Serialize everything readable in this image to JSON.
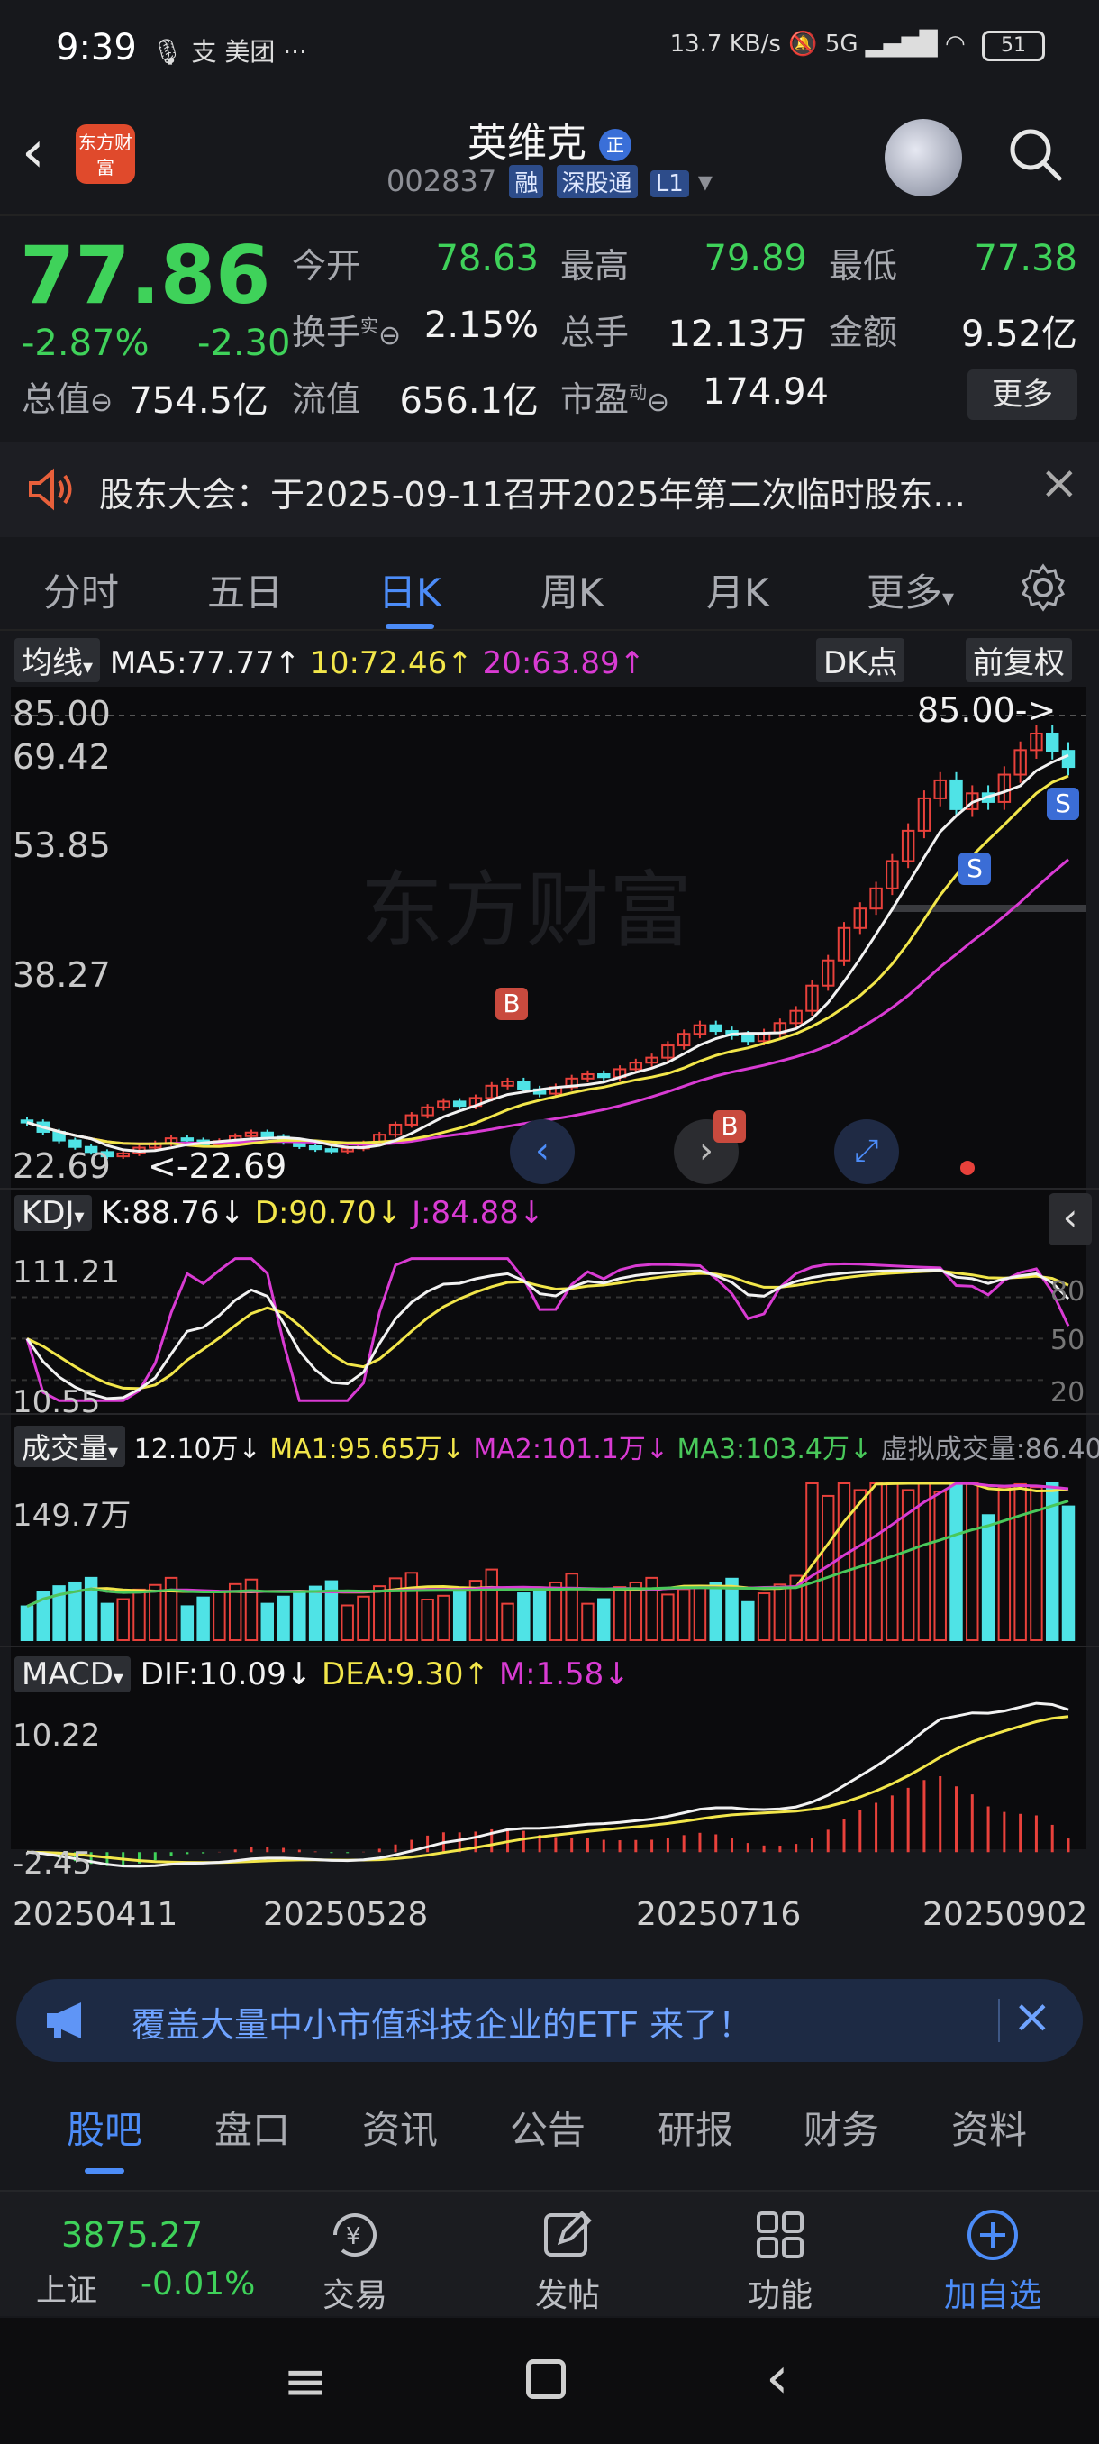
{
  "status_bar": {
    "time": "9:39",
    "app_icons": "🎙 支 美团 ···",
    "network_speed": "13.7 KB/s",
    "network_type": "5G",
    "battery": "51"
  },
  "header": {
    "back_icon": "chevron-left-icon",
    "logo_text": "东方财富",
    "stock_name": "英维克",
    "badge": "正",
    "code": "002837",
    "tags": [
      "融",
      "深股通",
      "L1"
    ]
  },
  "quote": {
    "price": "77.86",
    "change_pct": "-2.87%",
    "change": "-2.30",
    "fields": [
      {
        "label": "今开",
        "value": "78.63",
        "color": "green"
      },
      {
        "label": "最高",
        "value": "79.89",
        "color": "green"
      },
      {
        "label": "最低",
        "value": "77.38",
        "color": "green"
      },
      {
        "label": "换手",
        "sup": "实",
        "value": "2.15%",
        "color": "white"
      },
      {
        "label": "总手",
        "value": "12.13万",
        "color": "white"
      },
      {
        "label": "金额",
        "value": "9.52亿",
        "color": "white"
      },
      {
        "label": "总值",
        "value": "754.5亿",
        "color": "white"
      },
      {
        "label": "流值",
        "value": "656.1亿",
        "color": "white"
      },
      {
        "label": "市盈",
        "sup": "动",
        "value": "174.94",
        "color": "white"
      }
    ],
    "more_label": "更多"
  },
  "notice": {
    "text": "股东大会：于2025-09-11召开2025年第二次临时股东..."
  },
  "kline_tabs": [
    "分时",
    "五日",
    "日K",
    "周K",
    "月K",
    "更多"
  ],
  "kline_active": "日K",
  "chart": {
    "ma_chip": "均线",
    "ma5": "MA5:77.77",
    "ma10": "10:72.46",
    "ma20": "20:63.89",
    "dk_chip": "DK点",
    "fq_chip": "前复权",
    "price_axis": [
      "85.00",
      "69.42",
      "53.85",
      "38.27",
      "22.69"
    ],
    "high_marker": "85.00->",
    "low_marker": "<-22.69",
    "watermark": "东方财富",
    "kdj_chip": "KDJ",
    "kdj_k": "K:88.76",
    "kdj_d": "D:90.70",
    "kdj_j": "J:84.88",
    "kdj_axis": [
      "111.21",
      "80",
      "50",
      "20",
      "10.55"
    ],
    "vol_chip": "成交量",
    "vol_now": "12.10万",
    "vol_ma1": "MA1:95.65万",
    "vol_ma2": "MA2:101.1万",
    "vol_ma3": "MA3:103.4万",
    "vol_virtual": "虚拟成交量:86.40万",
    "vol_axis": "149.7万",
    "macd_chip": "MACD",
    "macd_dif": "DIF:10.09",
    "macd_dea": "DEA:9.30",
    "macd_m": "M:1.58",
    "macd_axis": [
      "10.22",
      "-2.45"
    ],
    "dates": [
      "20250411",
      "20250528",
      "20250716",
      "20250902"
    ],
    "signals": {
      "buy": "B",
      "sell": "S"
    }
  },
  "chart_data": {
    "type": "candlestick",
    "price_range": [
      22.69,
      85.0
    ],
    "close": [
      28.5,
      27.2,
      26.0,
      25.1,
      24.4,
      23.8,
      24.2,
      25.0,
      25.6,
      26.3,
      26.0,
      25.4,
      25.9,
      26.6,
      27.1,
      26.5,
      25.8,
      25.2,
      24.8,
      24.5,
      24.9,
      25.6,
      26.8,
      28.2,
      29.5,
      30.6,
      31.4,
      30.8,
      31.9,
      33.6,
      34.2,
      33.1,
      32.5,
      33.4,
      34.6,
      35.2,
      34.8,
      35.9,
      36.8,
      37.5,
      39.2,
      40.8,
      42.0,
      41.2,
      40.6,
      39.8,
      40.9,
      42.3,
      44.0,
      47.5,
      51.0,
      55.5,
      58.2,
      61.0,
      64.8,
      69.0,
      73.5,
      76.0,
      72.0,
      74.2,
      73.0,
      76.8,
      80.2,
      82.5,
      80.1,
      77.86
    ],
    "ma5": 77.77,
    "ma10": 72.46,
    "ma20": 63.89
  }
}
